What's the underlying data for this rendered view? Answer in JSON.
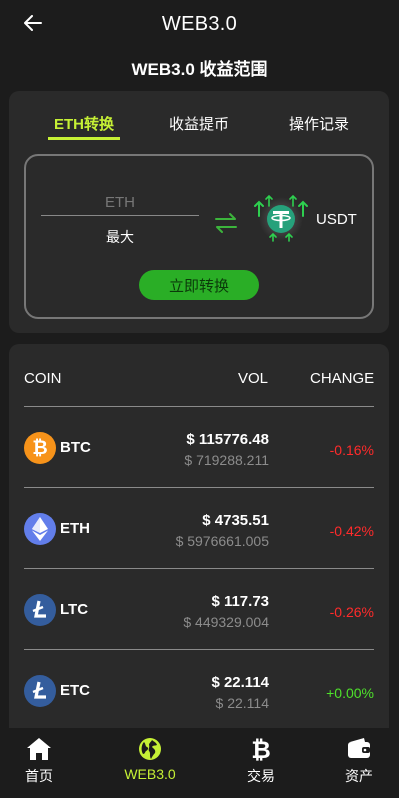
{
  "header": {
    "title": "WEB3.0",
    "heading": "WEB3.0 收益范围"
  },
  "tabs": [
    {
      "label": "ETH转换",
      "active": true
    },
    {
      "label": "收益提币",
      "active": false
    },
    {
      "label": "操作记录",
      "active": false
    }
  ],
  "convert": {
    "input_placeholder": "ETH",
    "input_value": "",
    "max_label": "最大",
    "target_label": "USDT",
    "button_label": "立即转换"
  },
  "market": {
    "headers": {
      "coin": "COIN",
      "vol": "VOL",
      "change": "CHANGE"
    },
    "rows": [
      {
        "symbol": "BTC",
        "icon": "bitcoin-icon",
        "color": "#f7931a",
        "price": "$ 115776.48",
        "vol": "$ 719288.211",
        "change": "-0.16%"
      },
      {
        "symbol": "ETH",
        "icon": "ethereum-icon",
        "color": "#627eea",
        "price": "$ 4735.51",
        "vol": "$ 5976661.005",
        "change": "-0.42%"
      },
      {
        "symbol": "LTC",
        "icon": "litecoin-icon",
        "color": "#345d9d",
        "price": "$ 117.73",
        "vol": "$ 449329.004",
        "change": "-0.26%"
      },
      {
        "symbol": "ETC",
        "icon": "litecoin-icon",
        "color": "#345d9d",
        "price": "$ 22.114",
        "vol": "$ 22.114",
        "change": "+0.00%"
      }
    ]
  },
  "nav": [
    {
      "label": "首页",
      "icon": "home-icon",
      "active": false
    },
    {
      "label": "WEB3.0",
      "icon": "globe-icon",
      "active": true
    },
    {
      "label": "交易",
      "icon": "bitcoin-icon",
      "active": false
    },
    {
      "label": "资产",
      "icon": "wallet-icon",
      "active": false
    }
  ],
  "colors": {
    "accent": "#c6f135",
    "negative": "#ff2b2b",
    "positive": "#4ee12b",
    "button_green": "#2aae26",
    "tether": "#26a17b"
  }
}
